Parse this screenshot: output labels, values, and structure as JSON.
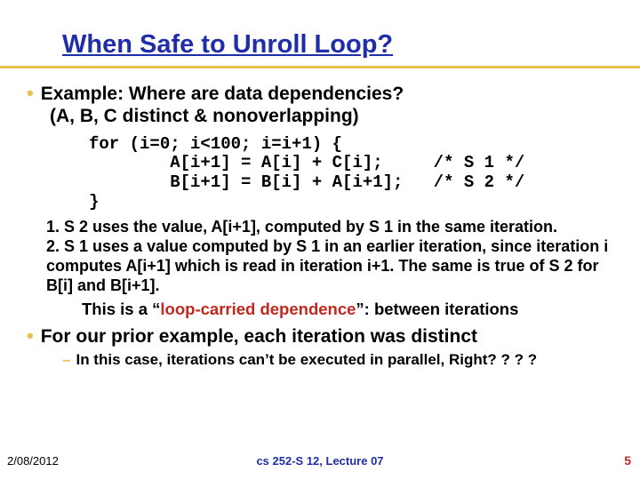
{
  "title": "When Safe to Unroll Loop?",
  "bullet1_line1": "Example: Where are data dependencies?",
  "bullet1_line2": "(A, B, C distinct & nonoverlapping)",
  "code": "for (i=0; i<100; i=i+1) {\n        A[i+1] = A[i] + C[i];     /* S 1 */\n        B[i+1] = B[i] + A[i+1];   /* S 2 */\n}",
  "num1": "1. S 2 uses the value, A[i+1], computed by S 1 in the same iteration.",
  "num2": "2. S 1 uses a value computed by S 1 in an earlier iteration, since iteration i computes A[i+1] which is read in iteration i+1. The same is true of S 2 for B[i] and B[i+1].",
  "loopdep_pre": "This is a “",
  "loopdep_red": "loop-carried dependence",
  "loopdep_post": "”: between iterations",
  "bullet2": "For our prior example, each iteration was distinct",
  "sub1": "In this case, iterations can’t be executed in parallel, Right? ? ? ?",
  "footer_date": "2/08/2012",
  "footer_center": "cs 252-S 12, Lecture 07",
  "footer_page": "5"
}
